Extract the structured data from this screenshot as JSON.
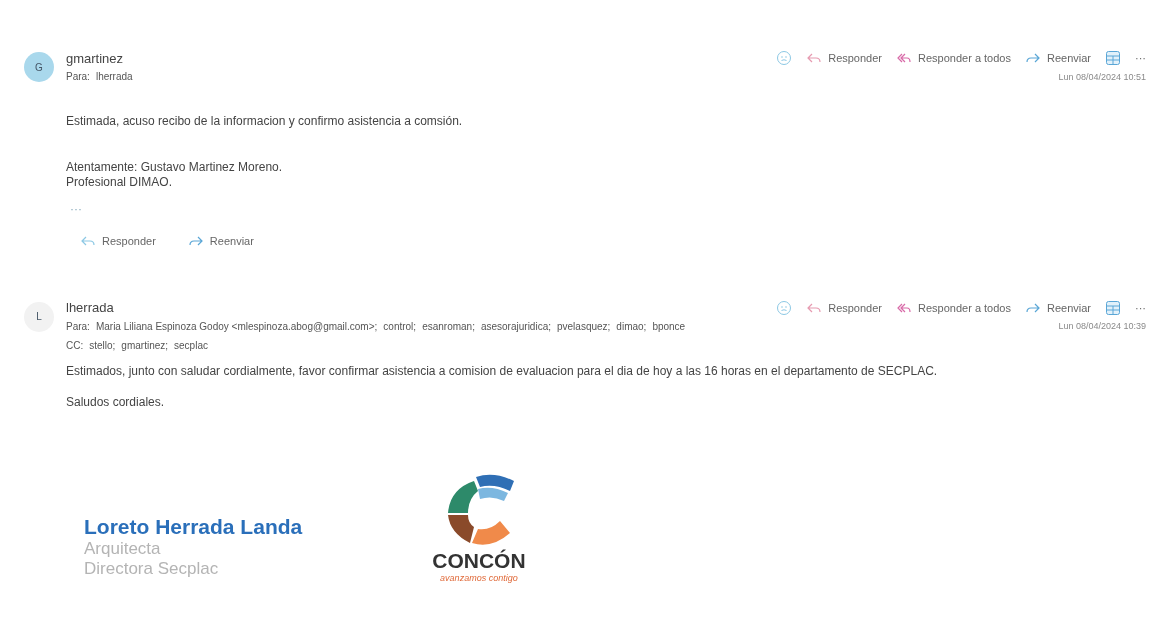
{
  "messages": [
    {
      "sender": "gmartinez",
      "initial": "G",
      "color": "#a9d8ec",
      "to_label": "Para:",
      "to": [
        "lherrada"
      ],
      "date": "Lun 08/04/2024 10:51",
      "actions": {
        "respond": "Responder",
        "respond_all": "Responder a todos",
        "forward": "Reenviar",
        "more": "···"
      },
      "body": [
        "Estimada, acuso recibo de la informacion y confirmo asistencia a comsión."
      ],
      "closing": [
        "Atentamente: Gustavo Martinez Moreno.",
        "Profesional DIMAO."
      ],
      "collapsed": "···",
      "footer_actions": [
        "Responder",
        "Reenviar"
      ]
    },
    {
      "sender": "lherrada",
      "initial": "L",
      "color": "#f2f2f2",
      "to_label": "Para:",
      "to": [
        "Maria Liliana Espinoza Godoy <mlespinoza.abog@gmail.com>;",
        "control;",
        "esanroman;",
        "asesorajuridica;",
        "pvelasquez;",
        "dimao;",
        "bponce"
      ],
      "cc_label": "CC:",
      "cc": [
        "stello;",
        "gmartinez;",
        "secplac"
      ],
      "date": "Lun 08/04/2024 10:39",
      "actions": {
        "respond": "Responder",
        "respond_all": "Responder a todos",
        "forward": "Reenviar",
        "more": "···"
      },
      "body": [
        "Estimados, junto con saludar cordialmente, favor confirmar asistencia a comision de evaluacion para el dia de hoy a las 16 horas en el departamento de SECPLAC.",
        "Saludos cordiales."
      ],
      "signature": {
        "name": "Loreto Herrada Landa",
        "lines": [
          "Arquitecta",
          "Directora Secplac"
        ],
        "logo_name": "CONCÓN",
        "logo_tagline": "avanzamos contigo"
      }
    }
  ]
}
